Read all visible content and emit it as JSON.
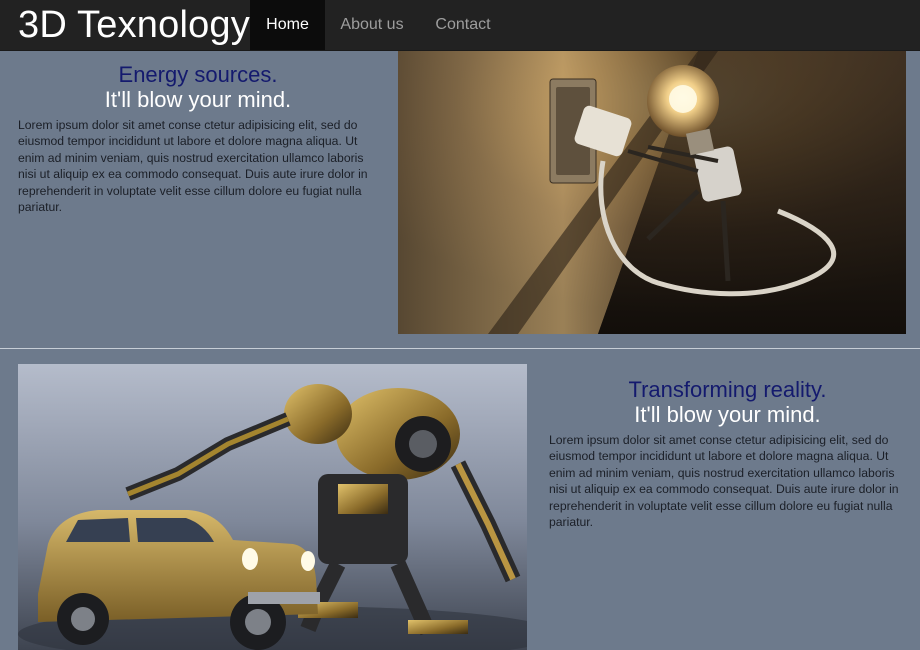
{
  "brand": {
    "title": "3D Texnology"
  },
  "nav": {
    "items": [
      {
        "label": "Home",
        "active": true
      },
      {
        "label": "About us",
        "active": false
      },
      {
        "label": "Contact",
        "active": false
      }
    ]
  },
  "sections": [
    {
      "headline": "Energy sources.",
      "tagline": "It'll blow your mind.",
      "body": "Lorem ipsum dolor sit amet conse ctetur adipisicing elit, sed do eiusmod tempor incididunt ut labore et dolore magna aliqua. Ut enim ad minim veniam, quis nostrud exercitation ullamco laboris nisi ut aliquip ex ea commodo consequat. Duis aute irure dolor in reprehenderit in voluptate velit esse cillum dolore eu fugiat nulla pariatur.",
      "image": "robot-lightbulb-plugging-in-image"
    },
    {
      "headline": "Transforming reality.",
      "tagline": "It'll blow your mind.",
      "body": "Lorem ipsum dolor sit amet conse ctetur adipisicing elit, sed do eiusmod tempor incididunt ut labore et dolore magna aliqua. Ut enim ad minim veniam, quis nostrud exercitation ullamco laboris nisi ut aliquip ex ea commodo consequat. Duis aute irure dolor in reprehenderit in voluptate velit esse cillum dolore eu fugiat nulla pariatur.",
      "image": "robot-transformer-and-car-image"
    }
  ],
  "colors": {
    "navbar": "#222222",
    "nav_active": "#0c0c0c",
    "page_background": "#6d7a8c",
    "headline": "#141a6e",
    "tagline": "#ffffff",
    "body_text": "#1b1f27"
  }
}
